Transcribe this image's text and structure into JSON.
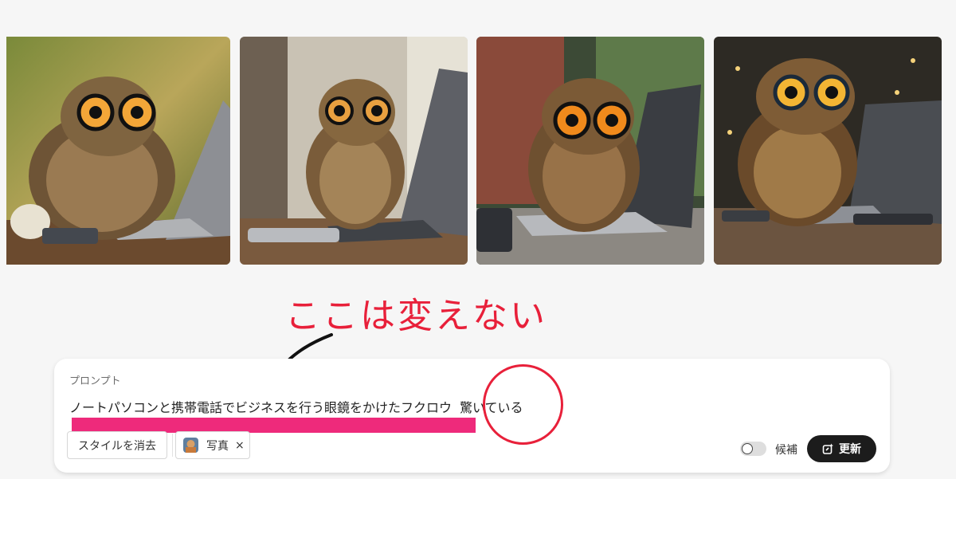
{
  "gallery": {
    "images": [
      {
        "alt": "owl-with-glasses-at-laptop-1"
      },
      {
        "alt": "owl-with-glasses-at-laptop-2"
      },
      {
        "alt": "owl-with-glasses-at-laptop-3"
      },
      {
        "alt": "owl-with-glasses-at-laptop-4"
      }
    ]
  },
  "annotation": {
    "text": "ここは変えない",
    "color": "#e8203a"
  },
  "prompt": {
    "label": "プロンプト",
    "text_main": "ノートパソコンと携帯電話でビジネスを行う眼鏡をかけたフクロウ",
    "text_added": "驚いている",
    "highlight_color": "#ee2a7b"
  },
  "chips": {
    "clear_style": "スタイルを消去",
    "style_name": "写真",
    "remove": "×"
  },
  "controls": {
    "toggle_label": "候補",
    "toggle_on": false,
    "update_label": "更新"
  }
}
